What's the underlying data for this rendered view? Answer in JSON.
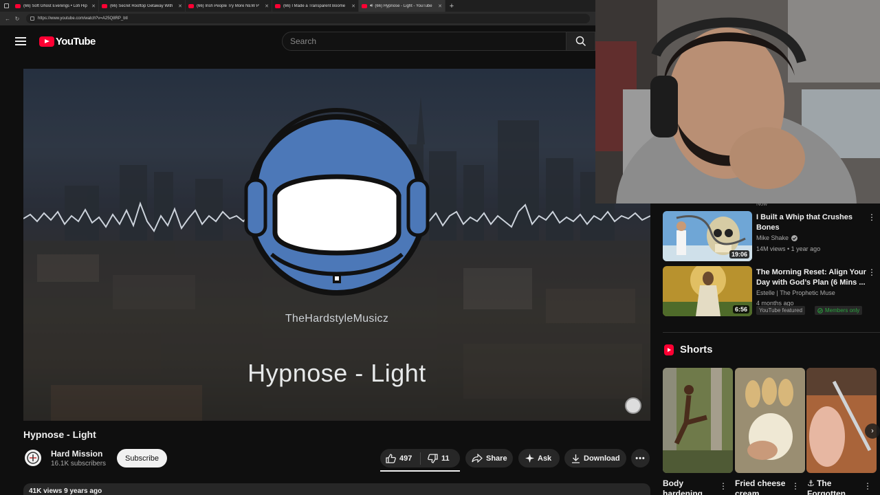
{
  "browser": {
    "tabs": [
      {
        "title": "(66) Soft Ghost Evenings • Lofi Hip",
        "active": false,
        "muted_icon": false
      },
      {
        "title": "(66) Secret Rooftop Getaway With",
        "active": false,
        "muted_icon": false
      },
      {
        "title": "(66) Irish People Try More NEW P",
        "active": false,
        "muted_icon": false
      },
      {
        "title": "(66) I Made a Transparent Boome",
        "active": false,
        "muted_icon": false
      },
      {
        "title": "(66) Hypnose - Light - YouTube",
        "active": true,
        "muted_icon": true
      }
    ],
    "url": "https://www.youtube.com/watch?v=A25Q8RP_btI"
  },
  "header": {
    "logo_text": "YouTube",
    "search_placeholder": "Search"
  },
  "player": {
    "channel_watermark": "TheHardstyleMusicz",
    "track_watermark": "Hypnose - Light"
  },
  "video": {
    "title": "Hypnose - Light",
    "channel_name": "Hard Mission",
    "subscribers": "16.1K subscribers",
    "subscribe_label": "Subscribe",
    "likes": "497",
    "dislikes": "11",
    "share_label": "Share",
    "ask_label": "Ask",
    "download_label": "Download",
    "description_stats": "41K views  9 years ago"
  },
  "sidebar": {
    "partial_label": "Now",
    "items": [
      {
        "title_line1": "I Built a Whip that Crushes",
        "title_line2": "Bones",
        "channel": "Mike Shake",
        "verified": true,
        "meta": "14M views • 1 year ago",
        "duration": "19:06"
      },
      {
        "title_line1": "The Morning Reset: Align Your",
        "title_line2": "Day with God’s Plan (6 Mins ...",
        "channel": "Estelle | The Prophetic Muse",
        "meta": "4 months ago",
        "duration": "6:56",
        "badge_featured": "YouTube featured",
        "badge_members": "Members only"
      }
    ],
    "shorts_heading": "Shorts",
    "shorts": [
      {
        "title": "Body hardening"
      },
      {
        "title": "Fried cheese cream"
      },
      {
        "title": "⚓ The Forgotten"
      }
    ]
  },
  "colors": {
    "brand_red": "#ff0033",
    "background": "#0f0f0f",
    "pill_bg": "#272727",
    "members_green": "#2ba640"
  }
}
